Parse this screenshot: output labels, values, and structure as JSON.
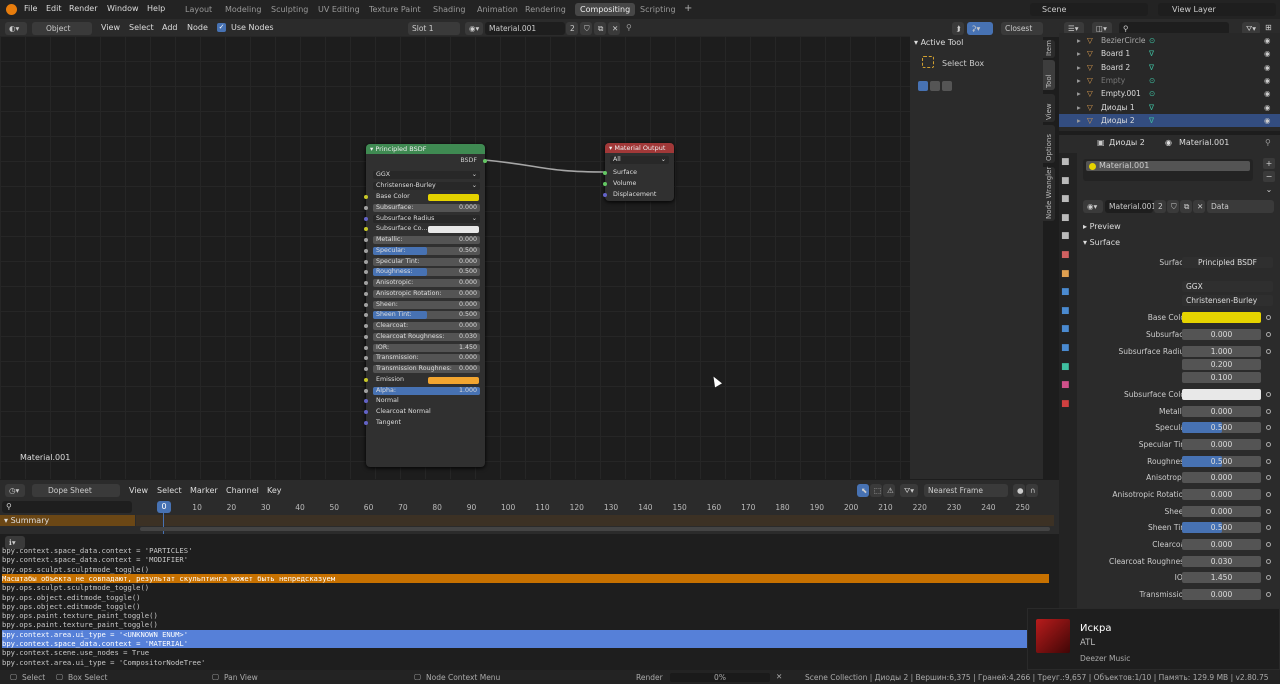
{
  "menubar": {
    "items": [
      "File",
      "Edit",
      "Render",
      "Window",
      "Help"
    ],
    "workspaces": [
      "Layout",
      "Modeling",
      "Sculpting",
      "UV Editing",
      "Texture Paint",
      "Shading",
      "Animation",
      "Rendering",
      "Compositing",
      "Scripting"
    ],
    "active_workspace": "Compositing",
    "add_tab": "+",
    "scene": "Scene",
    "view_layer": "View Layer"
  },
  "node_header": {
    "mode": "Object",
    "menus": [
      "View",
      "Select",
      "Add",
      "Node"
    ],
    "use_nodes": "Use Nodes",
    "slot": "Slot 1",
    "material": "Material.001",
    "users": "2",
    "snap": "Closest"
  },
  "node_editor": {
    "material_label": "Material.001",
    "principled": {
      "title": "Principled BSDF",
      "output": "BSDF",
      "dist": "GGX",
      "sss": "Christensen-Burley",
      "rows": [
        {
          "label": "Base Color",
          "value": "",
          "kind": "color",
          "color": "#e6d400"
        },
        {
          "label": "Subsurface:",
          "value": "0.000",
          "kind": "num"
        },
        {
          "label": "Subsurface Radius",
          "value": "",
          "kind": "select"
        },
        {
          "label": "Subsurface Co...",
          "value": "",
          "kind": "color",
          "color": "#e8e8e8"
        },
        {
          "label": "Metallic:",
          "value": "0.000",
          "kind": "num"
        },
        {
          "label": "Specular:",
          "value": "0.500",
          "kind": "bar",
          "fill": 0.5
        },
        {
          "label": "Specular Tint:",
          "value": "0.000",
          "kind": "num"
        },
        {
          "label": "Roughness:",
          "value": "0.500",
          "kind": "bar",
          "fill": 0.5
        },
        {
          "label": "Anisotropic:",
          "value": "0.000",
          "kind": "num"
        },
        {
          "label": "Anisotropic Rotation:",
          "value": "0.000",
          "kind": "num"
        },
        {
          "label": "Sheen:",
          "value": "0.000",
          "kind": "num"
        },
        {
          "label": "Sheen Tint:",
          "value": "0.500",
          "kind": "bar",
          "fill": 0.5
        },
        {
          "label": "Clearcoat:",
          "value": "0.000",
          "kind": "num"
        },
        {
          "label": "Clearcoat Roughness:",
          "value": "0.030",
          "kind": "num"
        },
        {
          "label": "IOR:",
          "value": "1.450",
          "kind": "num"
        },
        {
          "label": "Transmission:",
          "value": "0.000",
          "kind": "num"
        },
        {
          "label": "Transmission Roughnes:",
          "value": "0.000",
          "kind": "num"
        },
        {
          "label": "Emission",
          "value": "",
          "kind": "color",
          "color": "#f2a530"
        },
        {
          "label": "Alpha:",
          "value": "1.000",
          "kind": "bar",
          "fill": 1.0
        },
        {
          "label": "Normal",
          "value": "",
          "kind": "text"
        },
        {
          "label": "Clearcoat Normal",
          "value": "",
          "kind": "text"
        },
        {
          "label": "Tangent",
          "value": "",
          "kind": "text"
        }
      ]
    },
    "output": {
      "title": "Material Output",
      "target": "All",
      "inputs": [
        "Surface",
        "Volume",
        "Displacement"
      ]
    }
  },
  "n_panel": {
    "section": "Active Tool",
    "tool": "Select Box",
    "tabs": [
      "Item",
      "Tool",
      "View",
      "Options",
      "Node Wrangler"
    ]
  },
  "outliner": {
    "rows": [
      {
        "name": "BezierCircle",
        "color": "#aaa"
      },
      {
        "name": "Board 1",
        "color": "#ddd"
      },
      {
        "name": "Board 2",
        "color": "#ddd"
      },
      {
        "name": "Empty",
        "color": "#777"
      },
      {
        "name": "Empty.001",
        "color": "#ddd"
      },
      {
        "name": "Диоды 1",
        "color": "#ddd"
      },
      {
        "name": "Диоды 2",
        "color": "#ddd"
      }
    ]
  },
  "properties": {
    "object": "Диоды 2",
    "material": "Material.001",
    "slot_name": "Material.001",
    "mat_field": "Material.001",
    "users": "2",
    "link": "Data",
    "preview": "Preview",
    "surface_section": "Surface",
    "surface_label": "Surface",
    "surface_value": "Principled BSDF",
    "dist": "GGX",
    "sss": "Christensen-Burley",
    "rows": [
      {
        "label": "Base Color",
        "value": "",
        "kind": "color",
        "color": "#e6d400"
      },
      {
        "label": "Subsurface",
        "value": "0.000",
        "kind": "num"
      },
      {
        "label": "Subsurface Radius",
        "value": "1.000",
        "kind": "num"
      },
      {
        "label": "",
        "value": "0.200",
        "kind": "num"
      },
      {
        "label": "",
        "value": "0.100",
        "kind": "num"
      },
      {
        "label": "Subsurface Color",
        "value": "",
        "kind": "color",
        "color": "#e8e8e8"
      },
      {
        "label": "Metallic",
        "value": "0.000",
        "kind": "num"
      },
      {
        "label": "Specular",
        "value": "0.500",
        "kind": "bar",
        "fill": 0.5
      },
      {
        "label": "Specular Tint",
        "value": "0.000",
        "kind": "num"
      },
      {
        "label": "Roughness",
        "value": "0.500",
        "kind": "bar",
        "fill": 0.5
      },
      {
        "label": "Anisotropic",
        "value": "0.000",
        "kind": "num"
      },
      {
        "label": "Anisotropic Rotation",
        "value": "0.000",
        "kind": "num"
      },
      {
        "label": "Sheen",
        "value": "0.000",
        "kind": "num"
      },
      {
        "label": "Sheen Tint",
        "value": "0.500",
        "kind": "bar",
        "fill": 0.5
      },
      {
        "label": "Clearcoat",
        "value": "0.000",
        "kind": "num"
      },
      {
        "label": "Clearcoat Roughness",
        "value": "0.030",
        "kind": "num"
      },
      {
        "label": "IOR",
        "value": "1.450",
        "kind": "num"
      },
      {
        "label": "Transmission",
        "value": "0.000",
        "kind": "num"
      }
    ]
  },
  "dopesheet": {
    "mode": "Dope Sheet",
    "menus": [
      "View",
      "Select",
      "Marker",
      "Channel",
      "Key"
    ],
    "snap": "Nearest Frame",
    "summary": "Summary",
    "current_frame": "0",
    "ticks": [
      "10",
      "20",
      "30",
      "40",
      "50",
      "60",
      "70",
      "80",
      "90",
      "100",
      "110",
      "120",
      "130",
      "140",
      "150",
      "160",
      "170",
      "180",
      "190",
      "200",
      "210",
      "220",
      "230",
      "240",
      "250"
    ]
  },
  "console": {
    "lines": [
      {
        "text": "bpy.context.space_data.context = 'PARTICLES'",
        "hl": ""
      },
      {
        "text": "bpy.context.space_data.context = 'MODIFIER'",
        "hl": ""
      },
      {
        "text": "bpy.ops.sculpt.sculptmode_toggle()",
        "hl": ""
      },
      {
        "text": "Масштабы объекта не совпадают, результат скульптинга может быть непредсказуем",
        "hl": "warn"
      },
      {
        "text": "bpy.ops.sculpt.sculptmode_toggle()",
        "hl": ""
      },
      {
        "text": "bpy.ops.object.editmode_toggle()",
        "hl": ""
      },
      {
        "text": "bpy.ops.object.editmode_toggle()",
        "hl": ""
      },
      {
        "text": "bpy.ops.paint.texture_paint_toggle()",
        "hl": ""
      },
      {
        "text": "bpy.ops.paint.texture_paint_toggle()",
        "hl": ""
      },
      {
        "text": "bpy.context.area.ui_type = '<UNKNOWN ENUM>'",
        "hl": "sel"
      },
      {
        "text": "bpy.context.space_data.context = 'MATERIAL'",
        "hl": "sel"
      },
      {
        "text": "bpy.context.scene.use_nodes = True",
        "hl": ""
      },
      {
        "text": "bpy.context.area.ui_type = 'CompositorNodeTree'",
        "hl": ""
      }
    ]
  },
  "status": {
    "select": "Select",
    "box_select": "Box Select",
    "pan": "Pan View",
    "context_menu": "Node Context Menu",
    "render": "Render",
    "progress": "0%",
    "stats": "Scene Collection | Диоды 2 | Вершин:6,375 | Граней:4,266 | Треуг.:9,657 | Объектов:1/10 | Память: 129.9 MB | v2.80.75"
  },
  "notification": {
    "title": "Искра",
    "artist": "ATL",
    "app": "Deezer Music"
  },
  "colors": {
    "accent": "#4772b3",
    "warning": "#c77100",
    "node_green": "#3f8a52",
    "node_red": "#a13838"
  }
}
